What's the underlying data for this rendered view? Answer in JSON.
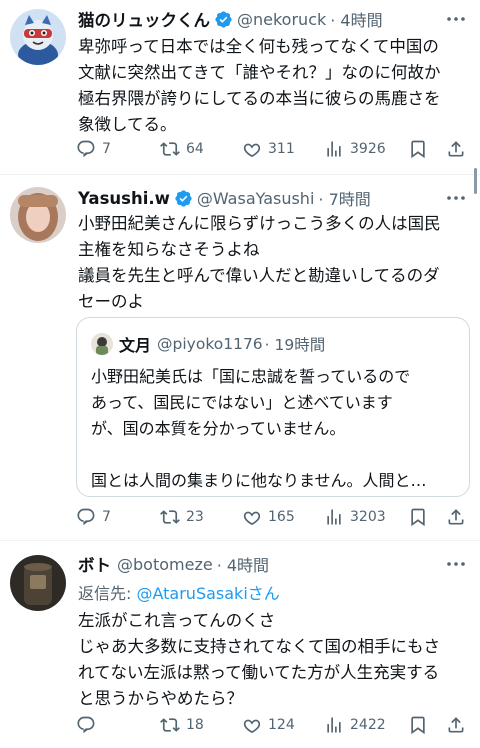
{
  "tweets": [
    {
      "name": "猫のリュックくん",
      "handle": "@nekoruck",
      "time": "· 4時間",
      "lines": [
        "卑弥呼って日本では全く何も残ってなくて中国の",
        "文献に突然出てきて「誰やそれ？」なのに何故か",
        "極右界隈が誇りにしてるの本当に彼らの馬鹿さを",
        "象徴してる。"
      ],
      "reply_count": "7",
      "retweet_count": "64",
      "like_count": "311",
      "view_count": "3926"
    },
    {
      "name": "Yasushi.w",
      "handle": "@WasaYasushi",
      "time": "· 7時間",
      "lines": [
        "小野田紀美さんに限らずけっこう多くの人は国民",
        "主権を知らなさそうよね",
        "議員を先生と呼んで偉い人だと勘違いしてるのダ",
        "セーのよ"
      ],
      "quote": {
        "name": "文月",
        "handle": "@piyoko1176",
        "time": "· 19時間",
        "lines": [
          "小野田紀美氏は「国に忠誠を誓っているので",
          "あって、国民にではない」と述べています",
          "が、国の本質を分かっていません。",
          "",
          "国とは人間の集まりに他なりません。人間と…"
        ]
      },
      "reply_count": "7",
      "retweet_count": "23",
      "like_count": "165",
      "view_count": "3203"
    },
    {
      "name": "ボト",
      "handle": "@botomeze",
      "time": "· 4時間",
      "reply_prefix": "返信先: ",
      "reply_target": "@AtaruSasakiさん",
      "lines": [
        "左派がこれ言ってんのくさ",
        "じゃあ大多数に支持されてなくて国の相手にもさ",
        "れてない左派は黙って働いてた方が人生充実する",
        "と思うからやめたら？"
      ],
      "reply_count": "",
      "retweet_count": "18",
      "like_count": "124",
      "view_count": "2422"
    }
  ],
  "colors": {
    "text": "#0f1419",
    "secondary": "#536471",
    "accent": "#1d9bf0",
    "border": "#cfd9de"
  },
  "icons": [
    "verified-badge-icon",
    "more-icon",
    "reply-icon",
    "retweet-icon",
    "like-icon",
    "views-icon",
    "bookmark-icon",
    "share-icon"
  ]
}
